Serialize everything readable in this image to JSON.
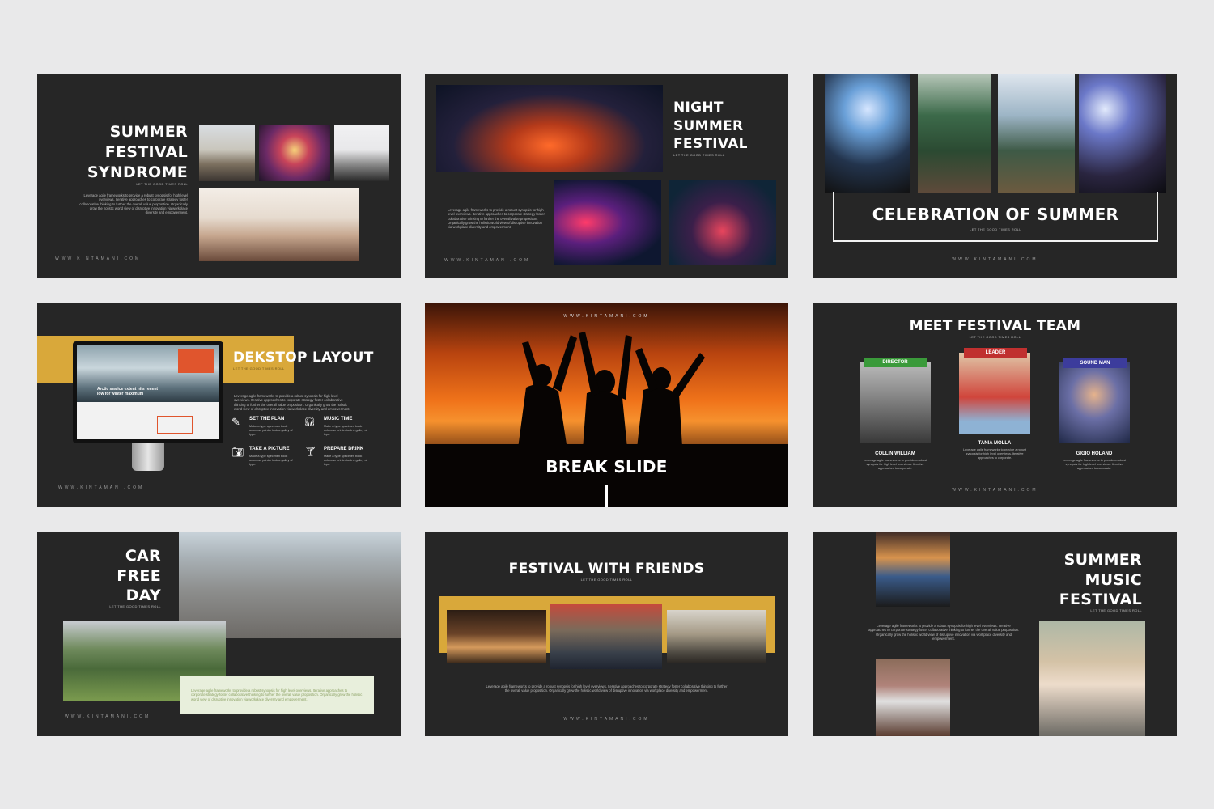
{
  "website": "WWW.KINTAMANI.COM",
  "tagline": "LET THE GOOD TIMES ROLL",
  "lorem_short": "Leverage agile frameworks to provide a robust synopsis for high level overviews. Iterative approaches to corporate strategy foster collaborative thinking to further the overall value proposition. Organically grow the holistic world view of disruptive innovation via workplace diversity and empowerment.",
  "lorem_mini": "Make a type specimen book unknown printer took a galley of type.",
  "colors": {
    "slide_bg": "#262626",
    "accent_gold": "#d9a83a",
    "page_bg": "#e9e9ea",
    "director": "#3a9a3a",
    "leader": "#c0302f",
    "sound_man": "#3c3c9c"
  },
  "slides": [
    {
      "title_lines": [
        "SUMMER",
        "FESTIVAL",
        "SYNDROME"
      ]
    },
    {
      "title_lines": [
        "NIGHT",
        "SUMMER",
        "FESTIVAL"
      ]
    },
    {
      "title": "CELEBRATION OF SUMMER"
    },
    {
      "title": "DEKSTOP LAYOUT",
      "monitor_headline_lines": [
        "Arctic sea ice extent hits recent",
        "low for winter maximum"
      ],
      "features": [
        {
          "icon": "pen-icon",
          "label": "SET THE PLAN"
        },
        {
          "icon": "headphones-icon",
          "label": "MUSIC TIME"
        },
        {
          "icon": "camera-icon",
          "label": "TAKE A PICTURE"
        },
        {
          "icon": "cocktail-icon",
          "label": "PREPARE DRINK"
        }
      ]
    },
    {
      "title": "BREAK SLIDE"
    },
    {
      "title": "MEET FESTIVAL TEAM",
      "members": [
        {
          "role": "DIRECTOR",
          "name": "COLLIN WILLIAM",
          "desc": "Leverage agile frameworks to provide a robust synopsis for high level overviews. Iterative approaches to corporate."
        },
        {
          "role": "LEADER",
          "name": "TANIA MOLLA",
          "desc": "Leverage agile frameworks to provide a robust synopsis for high level overviews. Iterative approaches to corporate."
        },
        {
          "role": "SOUND MAN",
          "name": "GIGIO HOLAND",
          "desc": "Leverage agile frameworks to provide a robust synopsis for high level overviews. Iterative approaches to corporate."
        }
      ]
    },
    {
      "title_lines": [
        "CAR",
        "FREE",
        "DAY"
      ]
    },
    {
      "title": "FESTIVAL WITH FRIENDS"
    },
    {
      "title_lines": [
        "SUMMER",
        "MUSIC",
        "FESTIVAL"
      ]
    }
  ]
}
